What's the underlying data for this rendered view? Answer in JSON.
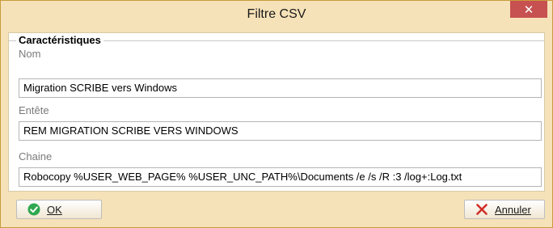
{
  "window": {
    "title": "Filtre CSV",
    "close_symbol": "✕"
  },
  "group": {
    "title": "Caractéristiques"
  },
  "fields": [
    {
      "label": "Nom",
      "value": "Migration SCRIBE vers Windows"
    },
    {
      "label": "Entête",
      "value": "REM MIGRATION SCRIBE VERS WINDOWS"
    },
    {
      "label": "Chaine",
      "value": "Robocopy %USER_WEB_PAGE% %USER_UNC_PATH%\\Documents /e /s /R :3 /log+:Log.txt"
    }
  ],
  "buttons": {
    "ok_label": "OK",
    "cancel_label": "Annuler"
  },
  "colors": {
    "frame": "#f6e2b8",
    "close": "#c75050",
    "ok_icon": "#2fa84f",
    "cancel_icon": "#d0302a"
  },
  "icons": {
    "ok": "check-circle-icon",
    "cancel": "x-mark-icon",
    "close": "close-icon"
  }
}
